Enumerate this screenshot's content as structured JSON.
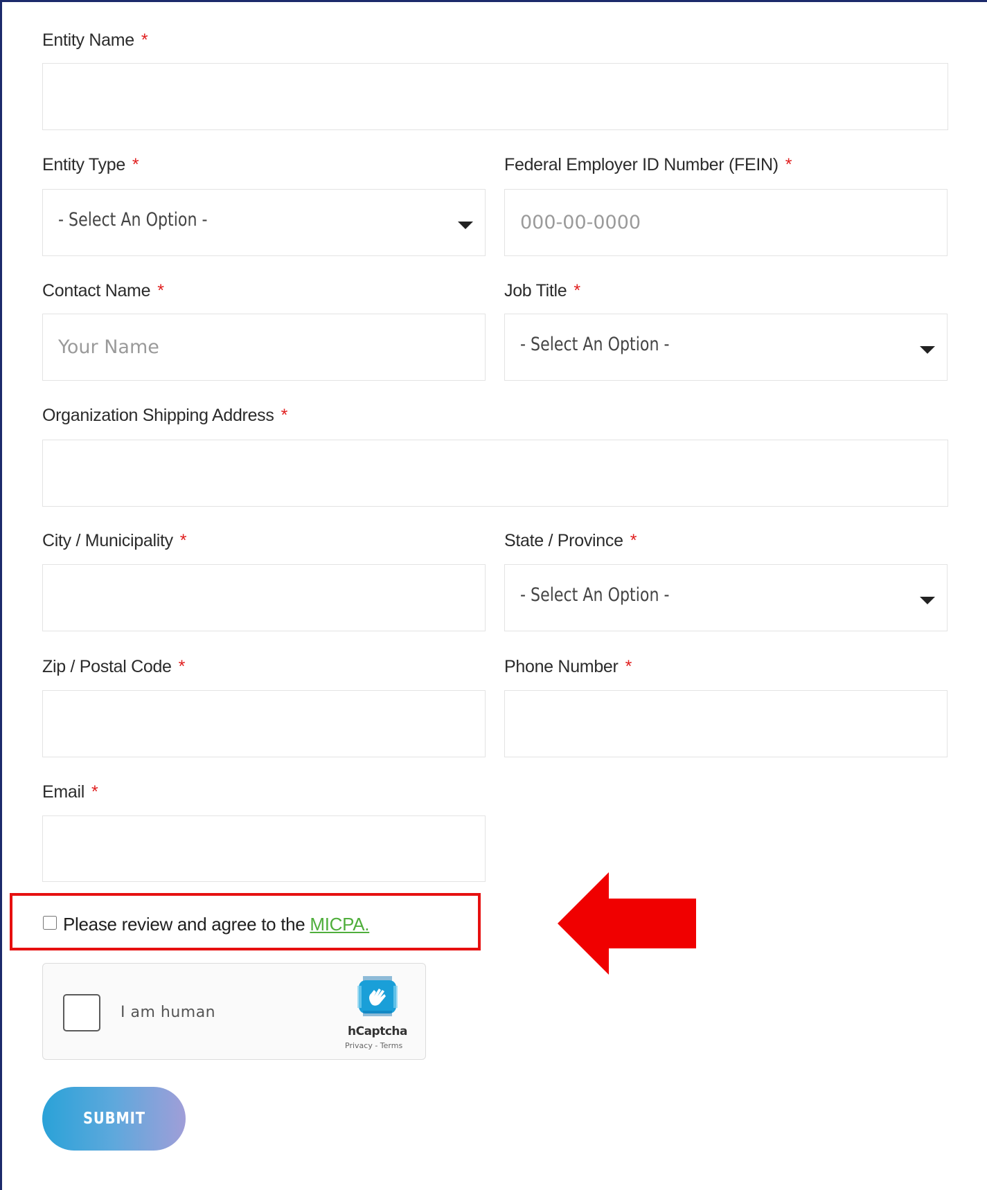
{
  "form": {
    "entity_name": {
      "label": "Entity Name",
      "required_mark": "*",
      "value": ""
    },
    "entity_type": {
      "label": "Entity Type",
      "required_mark": "*",
      "selected": "- Select An Option -"
    },
    "fein": {
      "label": "Federal Employer ID Number (FEIN)",
      "required_mark": "*",
      "placeholder": "000-00-0000"
    },
    "contact_name": {
      "label": "Contact Name",
      "required_mark": "*",
      "placeholder": "Your Name"
    },
    "job_title": {
      "label": "Job Title",
      "required_mark": "*",
      "selected": "- Select An Option -"
    },
    "shipping_address": {
      "label": "Organization Shipping Address",
      "required_mark": "*",
      "value": ""
    },
    "city": {
      "label": "City / Municipality",
      "required_mark": "*",
      "value": ""
    },
    "state": {
      "label": "State / Province",
      "required_mark": "*",
      "selected": "- Select An Option -"
    },
    "zip": {
      "label": "Zip / Postal Code",
      "required_mark": "*",
      "value": ""
    },
    "phone": {
      "label": "Phone Number",
      "required_mark": "*",
      "value": ""
    },
    "email": {
      "label": "Email",
      "required_mark": "*",
      "value": ""
    },
    "agreement": {
      "text": "Please review and agree to the ",
      "link_text": "MICPA."
    },
    "captcha": {
      "label": "I am human",
      "brand": "hCaptcha",
      "terms": "Privacy - Terms"
    },
    "submit_label": "SUBMIT"
  },
  "colors": {
    "required": "#e01e1e",
    "link": "#4fae3b",
    "highlight": "#e61010",
    "frame_border": "#1c2a6b",
    "submit_gradient_start": "#2aa2d8",
    "submit_gradient_end": "#a09ed8"
  },
  "icons": {
    "dropdown": "caret-down-icon",
    "callout": "red-arrow-left-icon",
    "captcha_logo": "hcaptcha-logo-icon"
  }
}
